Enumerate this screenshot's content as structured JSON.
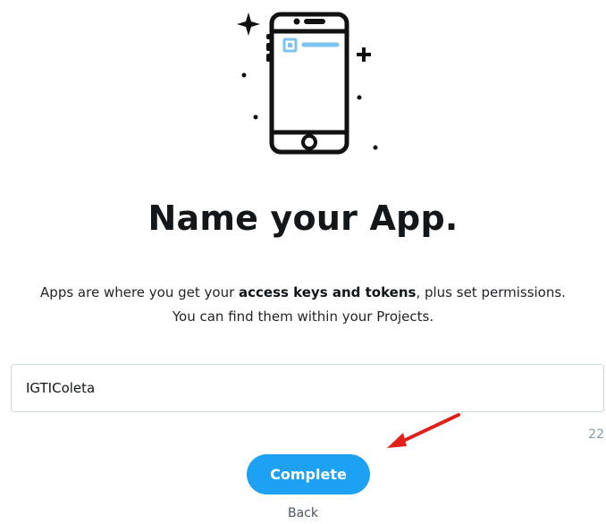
{
  "page": {
    "title": "Name your App.",
    "description_part1": "Apps are where you get your ",
    "description_bold": "access keys and tokens",
    "description_part2": ", plus set permissions.",
    "description_line2": "You can find them within your Projects."
  },
  "form": {
    "app_name_value": "IGTIColeta",
    "char_counter": "22"
  },
  "actions": {
    "complete_label": "Complete",
    "back_label": "Back"
  },
  "colors": {
    "accent": "#1da1f2",
    "annotation_arrow": "#e0201b"
  },
  "icons": {
    "illustration": "smartphone-icon",
    "annotation": "red-arrow-icon"
  }
}
